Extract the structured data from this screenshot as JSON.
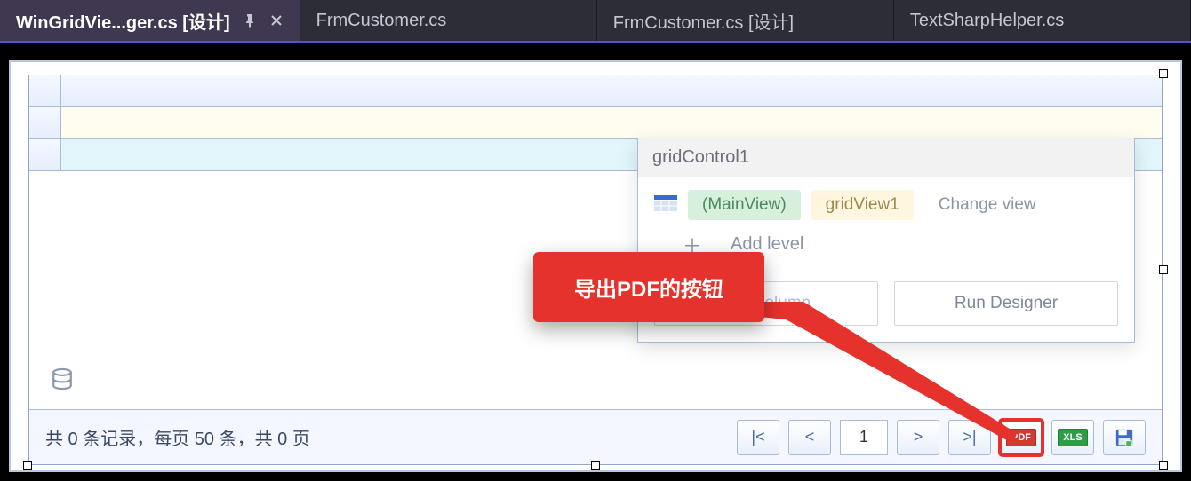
{
  "tabs": [
    {
      "label": "WinGridVie...ger.cs [设计]",
      "active": true
    },
    {
      "label": "FrmCustomer.cs",
      "active": false
    },
    {
      "label": "FrmCustomer.cs [设计]",
      "active": false
    },
    {
      "label": "TextSharpHelper.cs",
      "active": false
    }
  ],
  "smart_tag": {
    "title": "gridControl1",
    "main_view": "(MainView)",
    "view_name": "gridView1",
    "change_view": "Change view",
    "add_level": "Add level",
    "buttons": {
      "add_column": "Add column",
      "run_designer": "Run Designer"
    }
  },
  "callout": {
    "text": "导出PDF的按钮"
  },
  "footer": {
    "status": "共 0 条记录，每页 50 条，共 0 页",
    "pager": {
      "first": "|<",
      "prev": "<",
      "page": "1",
      "next": ">",
      "last": ">|"
    },
    "export": {
      "pdf": "PDF",
      "xls": "XLS"
    }
  }
}
